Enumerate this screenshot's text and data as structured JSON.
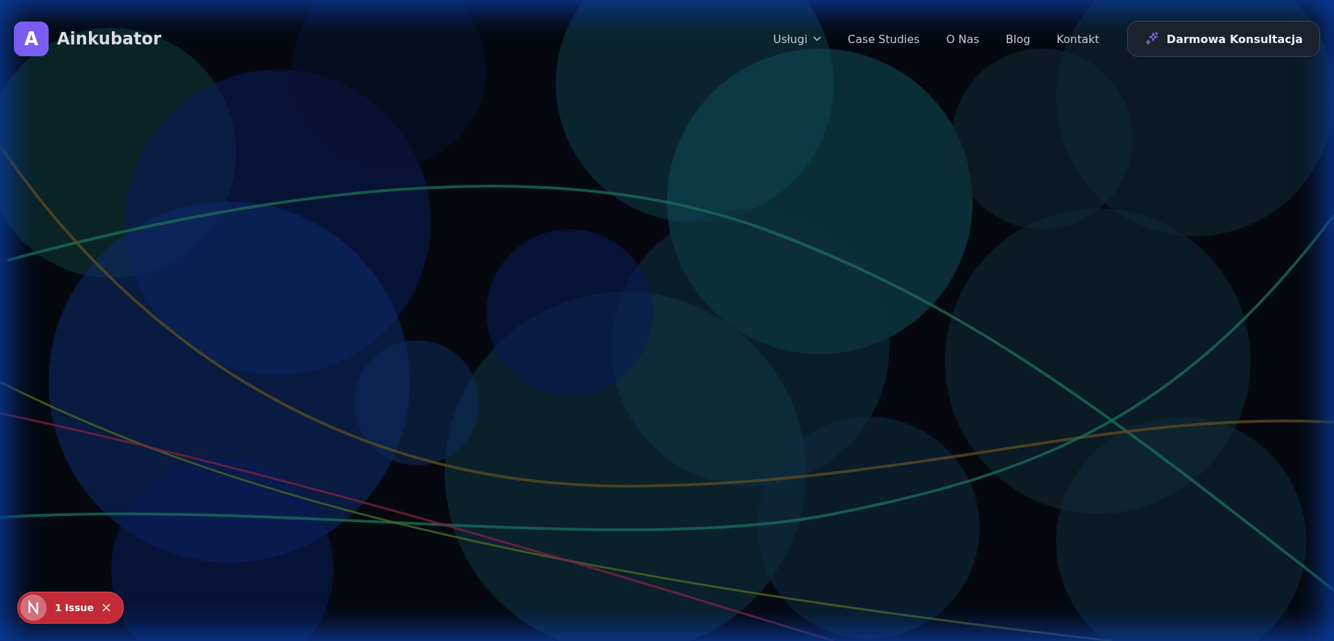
{
  "brand": {
    "logo_letter": "A",
    "name": "Ainkubator"
  },
  "nav": [
    {
      "label": "Usługi",
      "kind": "dropdown"
    },
    {
      "label": "Case Studies",
      "kind": "link"
    },
    {
      "label": "O Nas",
      "kind": "link"
    },
    {
      "label": "Blog",
      "kind": "link"
    },
    {
      "label": "Kontakt",
      "kind": "link"
    }
  ],
  "cta": {
    "label": "Darmowa Konsultacja"
  },
  "dev_badge": {
    "label": "1 Issue"
  }
}
